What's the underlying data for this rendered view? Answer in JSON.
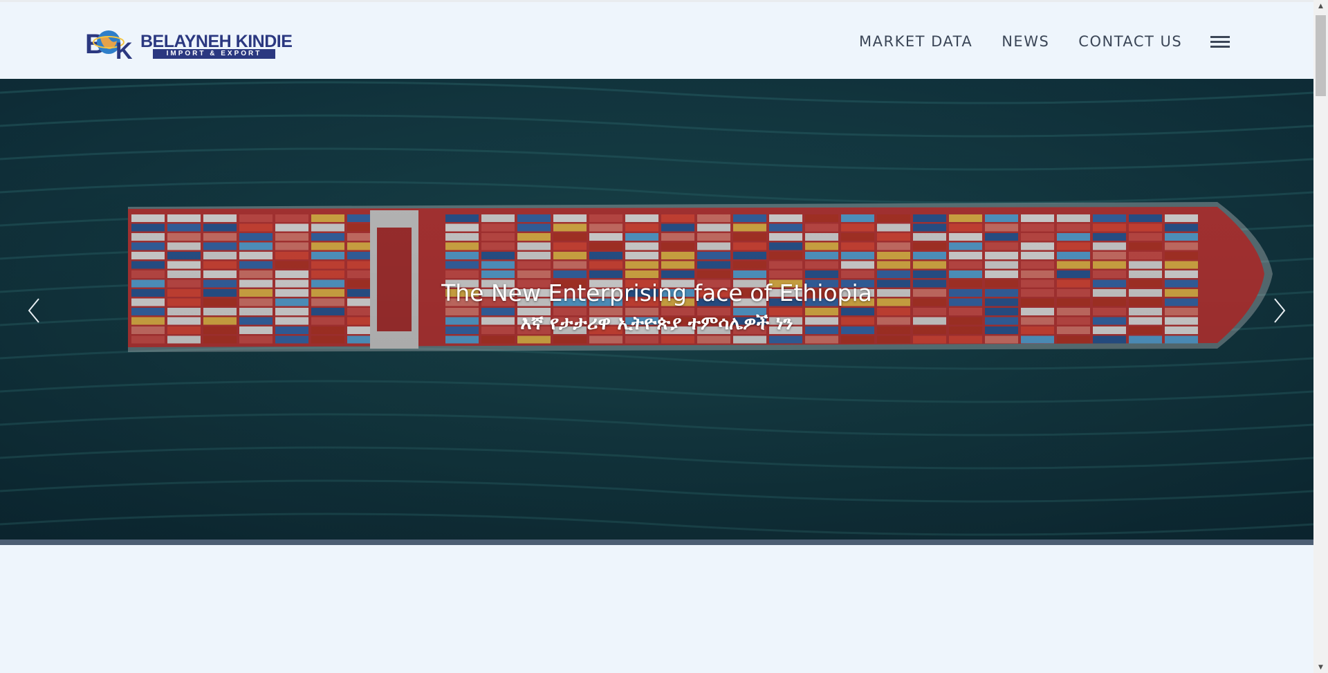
{
  "brand": {
    "mark": "BK",
    "name": "BELAYNEH KINDIE",
    "tagline": "IMPORT & EXPORT",
    "color": "#2b3880"
  },
  "nav": {
    "items": [
      {
        "label": "MARKET DATA"
      },
      {
        "label": "NEWS"
      },
      {
        "label": "CONTACT US"
      }
    ],
    "menu_icon": "hamburger-menu-icon"
  },
  "hero": {
    "title": "The New Enterprising face of Ethiopia",
    "subtitle": "እኛ የታታሪዋ ኢትዮጵያ ተምሳሌዎች ነን",
    "prev_icon": "chevron-left-icon",
    "next_icon": "chevron-right-icon",
    "image_subject": "container-ship-aerial-photo"
  },
  "colors": {
    "page_bg": "#eef5fc",
    "nav_text": "#3b4657",
    "hero_sea": "#123c44"
  }
}
